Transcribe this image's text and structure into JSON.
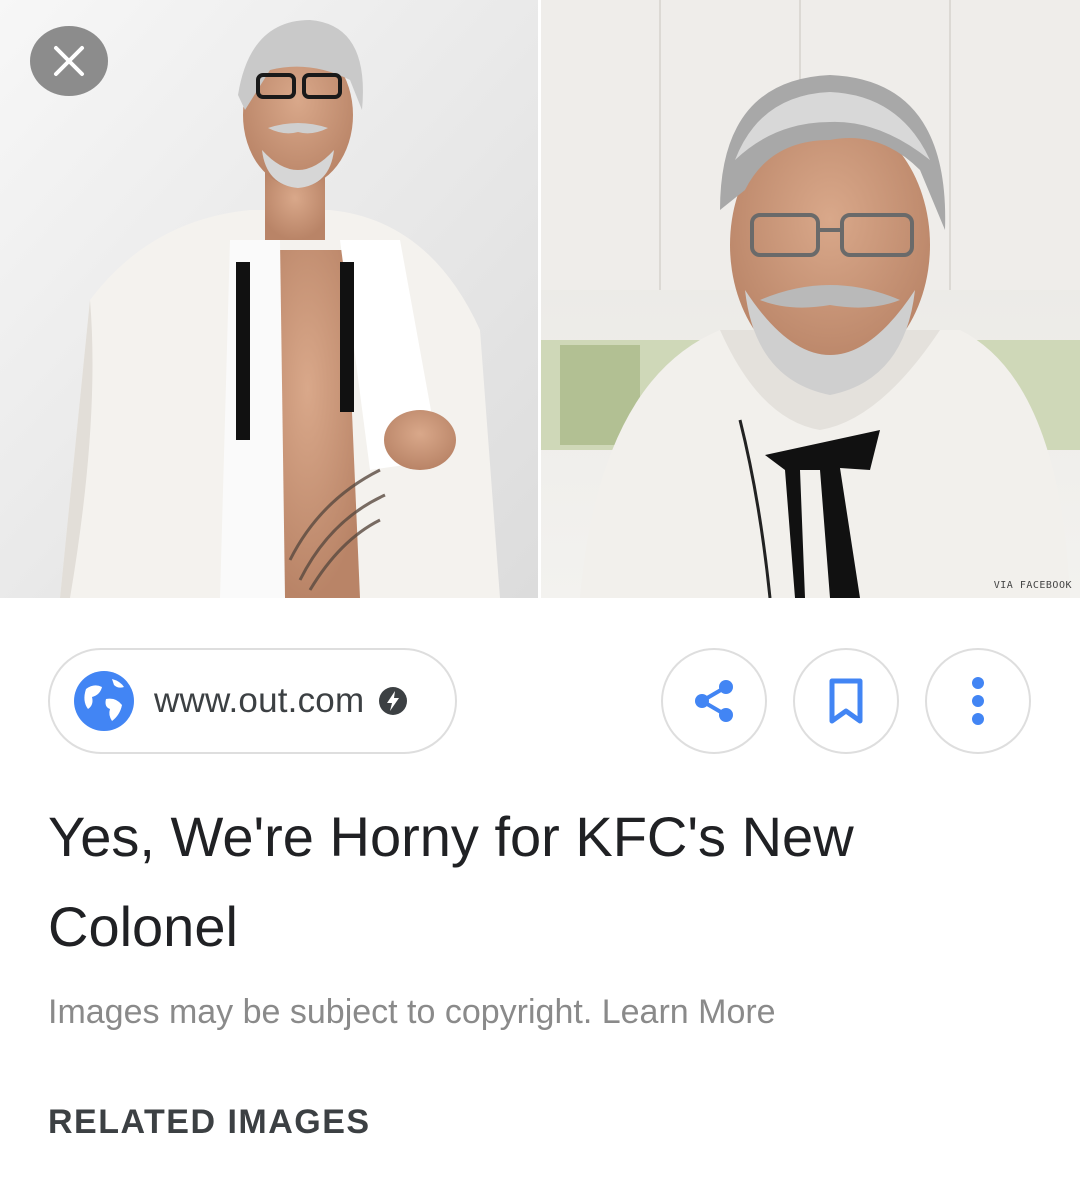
{
  "preview": {
    "watermark": "VIA FACEBOOK"
  },
  "source": {
    "domain": "www.out.com"
  },
  "result": {
    "title": "Yes, We're Horny for KFC's New Colonel"
  },
  "copyright": {
    "text": "Images may be subject to copyright.",
    "learn_more": "Learn More"
  },
  "related": {
    "heading": "RELATED IMAGES"
  },
  "icons": {
    "close": "close-icon",
    "globe": "globe-icon",
    "amp": "amp-lightning-icon",
    "share": "share-icon",
    "save": "bookmark-icon",
    "more": "more-vert-icon"
  },
  "colors": {
    "accent_blue": "#4285f4",
    "title_text": "#202124",
    "muted_text": "#8a8a8a",
    "chip_border": "#dedede"
  }
}
